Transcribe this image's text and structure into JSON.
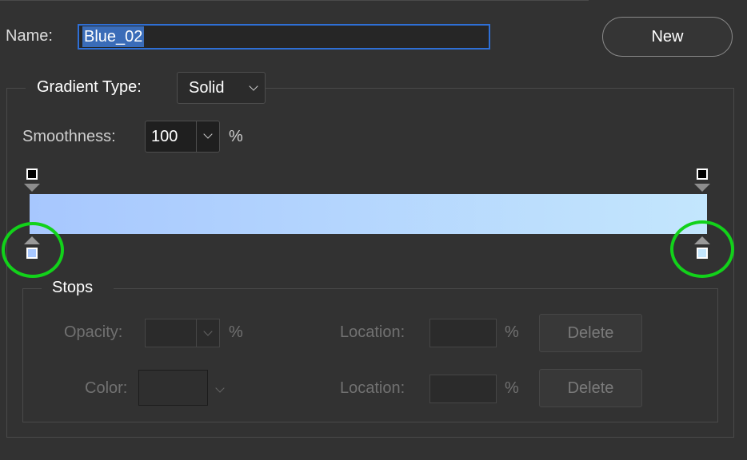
{
  "header": {
    "name_label": "Name:",
    "name_value": "Blue_02",
    "new_button": "New"
  },
  "gradient": {
    "type_label": "Gradient Type:",
    "type_value": "Solid",
    "smoothness_label": "Smoothness:",
    "smoothness_value": "100",
    "smoothness_unit": "%",
    "colors": {
      "left_stop": "#a7c7fe",
      "right_stop": "#c3e6fd",
      "opacity_stop": "#000000",
      "highlight": "#12d21a",
      "selection": "#2e6fd6"
    }
  },
  "stops": {
    "title": "Stops",
    "opacity_label": "Opacity:",
    "opacity_unit": "%",
    "location_label": "Location:",
    "location_unit": "%",
    "color_label": "Color:",
    "delete_label": "Delete"
  }
}
